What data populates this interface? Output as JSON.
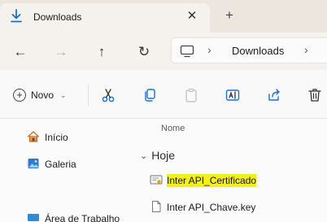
{
  "tab": {
    "title": "Downloads",
    "icon": "download-icon",
    "close": "✕",
    "new_tab": "+"
  },
  "nav": {
    "back": "←",
    "forward": "→",
    "up": "↑",
    "refresh": "↻",
    "address": {
      "chev1": "›",
      "location": "Downloads",
      "chev2": "›"
    }
  },
  "toolbar": {
    "new_label": "Novo",
    "new_caret": "⌄"
  },
  "sidebar": {
    "items": [
      {
        "label": "Início",
        "icon": "home-icon"
      },
      {
        "label": "Galeria",
        "icon": "gallery-icon"
      },
      {
        "label": "Área de Trabalho",
        "icon": "desktop-icon"
      }
    ]
  },
  "list": {
    "column_name": "Nome",
    "group": {
      "chevron": "⌄",
      "label": "Hoje"
    },
    "files": [
      {
        "name": "Inter API_Certificado",
        "icon": "certificate-icon",
        "highlighted": true
      },
      {
        "name": "Inter API_Chave.key",
        "icon": "file-icon",
        "highlighted": false
      }
    ]
  }
}
